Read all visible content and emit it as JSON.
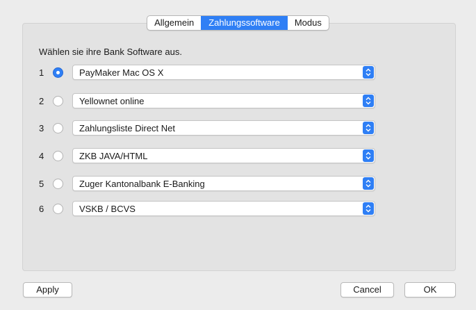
{
  "tabs": [
    {
      "label": "Allgemein",
      "active": false
    },
    {
      "label": "Zahlungssoftware",
      "active": true
    },
    {
      "label": "Modus",
      "active": false
    }
  ],
  "instruction": "Wählen sie ihre Bank Software aus.",
  "rows": [
    {
      "number": "1",
      "selected": true,
      "value": "PayMaker Mac OS X"
    },
    {
      "number": "2",
      "selected": false,
      "value": "Yellownet online"
    },
    {
      "number": "3",
      "selected": false,
      "value": "Zahlungsliste Direct Net"
    },
    {
      "number": "4",
      "selected": false,
      "value": "ZKB JAVA/HTML"
    },
    {
      "number": "5",
      "selected": false,
      "value": "Zuger Kantonalbank E-Banking"
    },
    {
      "number": "6",
      "selected": false,
      "value": "VSKB / BCVS"
    }
  ],
  "buttons": {
    "apply": "Apply",
    "cancel": "Cancel",
    "ok": "OK"
  },
  "colors": {
    "accent": "#2f7ff5"
  }
}
